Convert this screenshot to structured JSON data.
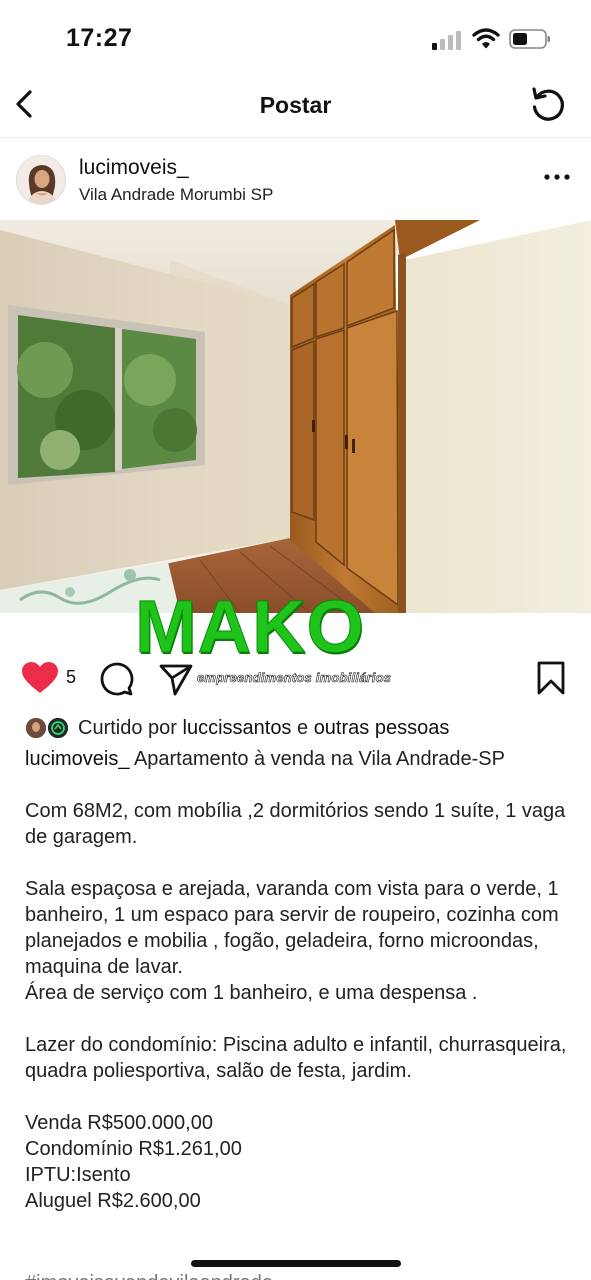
{
  "status": {
    "time": "17:27"
  },
  "nav": {
    "title": "Postar",
    "icons": [
      "chevron-left-icon",
      "refresh-icon"
    ]
  },
  "post": {
    "username": "lucimoveis_",
    "location": "Vila Andrade Morumbi SP",
    "watermark": {
      "title": "MAKO",
      "subtitle": "empreendimentos imobiliários"
    },
    "likes": "5",
    "liked_prefix": "Curtido por ",
    "liked_user": "luccissantos",
    "liked_join": " e ",
    "liked_others": "outras pessoas",
    "caption_user": "lucimoveis_",
    "caption_first": " Apartamento à venda na Vila Andrade-SP",
    "caption_paragraphs": [
      "Com 68M2, com mobília ,2 dormitórios sendo 1 suíte, 1 vaga de garagem.",
      "Sala espaçosa e arejada, varanda com vista para o verde, 1 banheiro, 1 um espaco para servir de roupeiro, cozinha com  planejados e mobilia , fogão, geladeira, forno microondas, maquina de lavar.\nÁrea de serviço com 1 banheiro, e uma despensa .",
      "Lazer do condomínio: Piscina adulto e infantil, churrasqueira, quadra poliesportiva, salão de festa, jardim.",
      "Venda R$500.000,00\nCondomínio R$1.261,00\nIPTU:Isento\nAluguel R$2.600,00"
    ],
    "caption_cut": "#imoveisavendavilaandrade"
  },
  "colors": {
    "heart": "#ed2c49",
    "watermark_green": "#1fc41a"
  }
}
